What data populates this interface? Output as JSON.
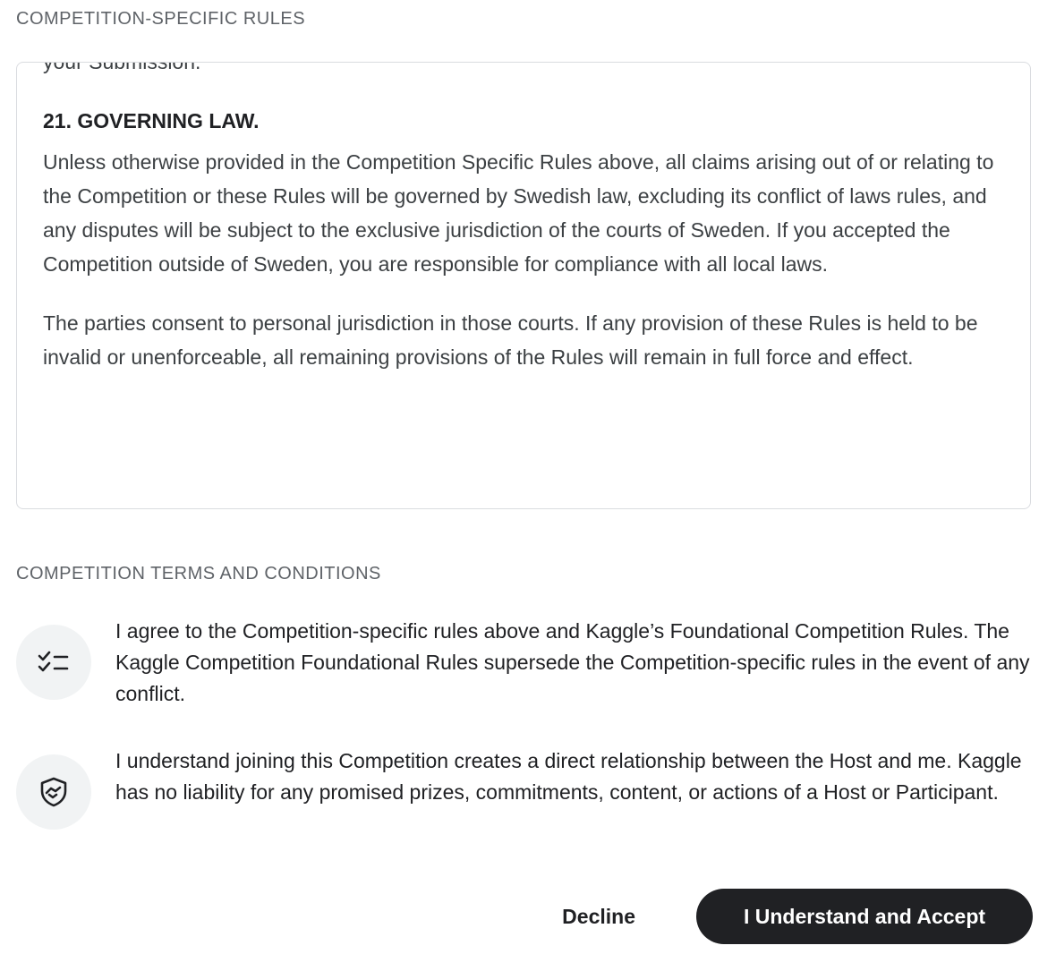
{
  "specific_rules": {
    "heading": "COMPETITION-SPECIFIC RULES",
    "clipped_text": "your Submission.",
    "law_heading": "21. GOVERNING LAW.",
    "paragraphs": [
      "Unless otherwise provided in the Competition Specific Rules above, all claims arising out of or relating to the Competition or these Rules will be governed by Swedish law, excluding its conflict of laws rules, and any disputes will be subject to the exclusive jurisdiction of the courts of Sweden. If you accepted the Competition outside of Sweden, you are responsible for compliance with all local laws.",
      "The parties consent to personal jurisdiction in those courts. If any provision of these Rules is held to be invalid or unenforceable, all remaining provisions of the Rules will remain in full force and effect."
    ]
  },
  "terms": {
    "heading": "COMPETITION TERMS AND CONDITIONS",
    "items": [
      {
        "icon": "checklist-icon",
        "text": "I agree to the Competition-specific rules above and Kaggle’s Foundational Competition Rules. The Kaggle Competition Foundational Rules supersede the Competition-specific rules in the event of any conflict."
      },
      {
        "icon": "shield-handshake-icon",
        "text": "I understand joining this Competition creates a direct relationship between the Host and me. Kaggle has no liability for any promised prizes, commitments, content, or actions of a Host or Participant."
      }
    ]
  },
  "actions": {
    "decline_label": "Decline",
    "accept_label": "I Understand and Accept"
  },
  "colors": {
    "primary_button": "#202124",
    "icon_bg": "#f1f3f4",
    "border": "#dadce0",
    "muted_text": "#5f6368"
  }
}
